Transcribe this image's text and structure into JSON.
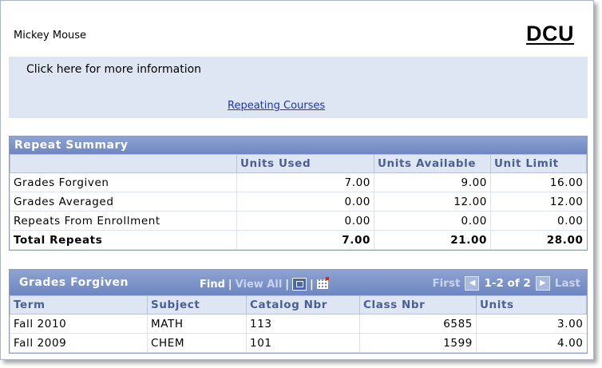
{
  "student_name": "Mickey Mouse",
  "logo_text": "DCU",
  "info_text": "Click here for more information",
  "info_link": "Repeating Courses",
  "repeat_summary": {
    "title": "Repeat Summary",
    "headers": [
      "",
      "Units Used",
      "Units Available",
      "Unit Limit"
    ],
    "rows": [
      [
        "Grades Forgiven",
        "7.00",
        "9.00",
        "16.00"
      ],
      [
        "Grades Averaged",
        "0.00",
        "12.00",
        "12.00"
      ],
      [
        "Repeats From Enrollment",
        "0.00",
        "0.00",
        "0.00"
      ],
      [
        "Total Repeats",
        "7.00",
        "21.00",
        "28.00"
      ]
    ]
  },
  "grades_forgiven": {
    "title": "Grades Forgiven",
    "find_label": "Find",
    "sep1": "|",
    "view_all_label": "View All",
    "sep2": "|",
    "sep3": "|",
    "first_label": "First",
    "range_label": "1-2 of 2",
    "last_label": "Last",
    "headers": [
      "Term",
      "Subject",
      "Catalog Nbr",
      "Class Nbr",
      "Units"
    ],
    "rows": [
      [
        "Fall 2010",
        "MATH",
        "113",
        "6585",
        "3.00"
      ],
      [
        "Fall 2009",
        "CHEM",
        "101",
        "1599",
        "4.00"
      ]
    ]
  },
  "icons": {
    "zoom": "zoom-grid-icon",
    "download": "download-to-spreadsheet-icon",
    "prev": "previous-arrow-icon",
    "next": "next-arrow-icon"
  },
  "colors": {
    "header_blue": "#6e86c0",
    "panel_light": "#dfe6f3",
    "column_header_text": "#4a5f93",
    "link": "#1a34c4"
  }
}
